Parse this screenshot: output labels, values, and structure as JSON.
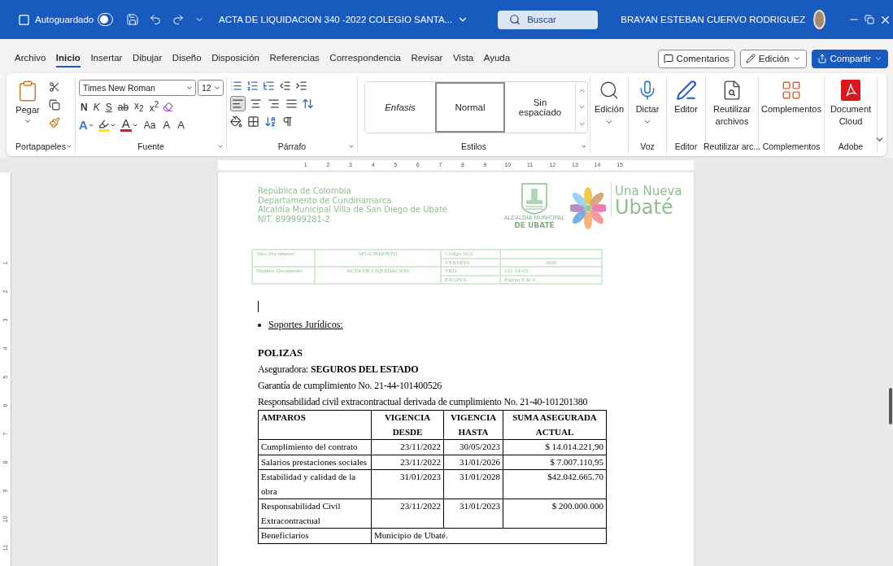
{
  "title_bar": {
    "autosave_label": "Autoguardado",
    "autosave_on": false,
    "document_title": "ACTA DE LIQUIDACION  340 -2022 COLEGIO SANTA...",
    "search_placeholder": "Buscar",
    "user_name": "BRAYAN ESTEBAN CUERVO RODRIGUEZ"
  },
  "menu_tabs": [
    {
      "label": "Archivo",
      "selected": false
    },
    {
      "label": "Inicio",
      "selected": true
    },
    {
      "label": "Insertar",
      "selected": false
    },
    {
      "label": "Dibujar",
      "selected": false
    },
    {
      "label": "Diseño",
      "selected": false
    },
    {
      "label": "Disposición",
      "selected": false
    },
    {
      "label": "Referencias",
      "selected": false
    },
    {
      "label": "Correspondencia",
      "selected": false
    },
    {
      "label": "Revisar",
      "selected": false
    },
    {
      "label": "Vista",
      "selected": false
    },
    {
      "label": "Ayuda",
      "selected": false
    }
  ],
  "menu_actions": [
    {
      "label": "Comentarios",
      "kind": "comments"
    },
    {
      "label": "Edición",
      "kind": "editing"
    },
    {
      "label": "Compartir",
      "kind": "share"
    }
  ],
  "ribbon": {
    "clipboard": {
      "paste_label": "Pegar",
      "group_label": "Portapapeles"
    },
    "font": {
      "name": "Times New Roman",
      "size": "12",
      "format_buttons": [
        "N",
        "K",
        "S",
        "ab",
        "x$_{2}$",
        "x$^{2}$"
      ],
      "color_buttons": [
        {
          "kind": "effect",
          "label": "A",
          "color": "#2f78d0"
        },
        {
          "kind": "highlight",
          "color": "#ffee00"
        },
        {
          "kind": "font",
          "label": "A",
          "color": "#e0161e"
        }
      ],
      "case_label": "Aa",
      "size_buttons": [
        "A",
        "A"
      ],
      "group_label": "Fuente"
    },
    "paragraph": {
      "alignment_buttons": [
        {
          "selected": true
        },
        {
          "selected": false
        },
        {
          "selected": false
        },
        {
          "selected": false
        }
      ],
      "group_label": "Párrafo"
    },
    "styles": {
      "items": [
        {
          "label": "Énfasis",
          "kind": "emphasis",
          "selected": false
        },
        {
          "label": "Normal",
          "kind": "normal",
          "selected": true
        },
        {
          "label": "Sin espaciado",
          "kind": "normal",
          "selected": false
        }
      ],
      "group_label": "Estilos"
    },
    "commands": [
      {
        "kind": "search",
        "label": "Edición",
        "dropdown": true
      },
      {
        "kind": "mic",
        "label": "Dictar",
        "dropdown": true,
        "group_label": "Voz"
      },
      {
        "kind": "pen",
        "label": "Editor",
        "dropdown": false,
        "group_label": "Editor"
      },
      {
        "kind": "reuse",
        "label": "Reutilizar archivos",
        "dropdown": false,
        "group_label": "Reutilizar arc..."
      },
      {
        "kind": "addins",
        "label": "Complementos",
        "dropdown": false,
        "group_label": "Complementos"
      },
      {
        "kind": "pdf",
        "label": "Document Cloud",
        "dropdown": false,
        "group_label": "Adobe"
      }
    ]
  },
  "ruler": {
    "horizontal": [
      "1",
      "2",
      "3",
      "4",
      "5",
      "6",
      "7",
      "8",
      "9",
      "10",
      "11",
      "12",
      "13",
      "14",
      "15"
    ],
    "vertical": [
      "1",
      "2",
      "3",
      "4",
      "5",
      "6",
      "7",
      "8",
      "9",
      "10",
      "11"
    ]
  },
  "document": {
    "letterhead": [
      "República de Colombia",
      "Departamento de Cundinamarca",
      "Alcaldía Municipal Villa de San Diego de Ubaté",
      "NIT. 899999281-2"
    ],
    "crest_caption_small": "ALCALDÍA MUNICIPAL",
    "crest_caption": "DE UBATÉ",
    "slogan_top": "Una Nueva",
    "slogan_bottom": "Ubaté",
    "header_table": {
      "left": [
        {
          "label": "Tipo Documento",
          "value": "SEGUIMIENTO"
        },
        {
          "label": "Nombre Documento",
          "value": "ACTA DE LIQUIDACION"
        }
      ],
      "right": [
        {
          "label": "Código SGC"
        },
        {
          "label": "VERSIÓN",
          "value": "2020"
        },
        {
          "label": "TRD",
          "value": "121-14-05"
        },
        {
          "label": "PÁGINA",
          "value": "Página 3 de 4"
        }
      ]
    },
    "bullet": "Soportes Jurídicos:",
    "heading": "POLIZAS",
    "lines": [
      "Aseguradora: **SEGUROS DEL ESTADO**",
      "Garantía de cumplimiento No. 21-44-101400526",
      "Responsabilidad civil extracontractual derivada de cumplimiento No. 21-40-101201380"
    ],
    "policy_table": {
      "columns": [
        "AMPAROS",
        "VIGENCIA DESDE",
        "VIGENCIA HASTA",
        "SUMA ASEGURADA ACTUAL"
      ],
      "rows": [
        [
          "Cumplimiento del contrato",
          "23/11/2022",
          "30/05/2023",
          "$ 14.014.221,90"
        ],
        [
          "Salarios prestaciones sociales",
          "23/11/2022",
          "31/01/2026",
          "$ 7.007.110,95"
        ],
        [
          "Estabilidad y calidad de la obra",
          "31/01/2023",
          "31/01/2028",
          "$42.042.665.70"
        ],
        [
          "Responsabilidad Civil Extracontractual",
          "23/11/2022",
          "31/01/2023",
          "$ 200.000.000"
        ]
      ],
      "footer": {
        "label": "Beneficiarios",
        "value": "Municipio de Ubaté."
      }
    }
  }
}
